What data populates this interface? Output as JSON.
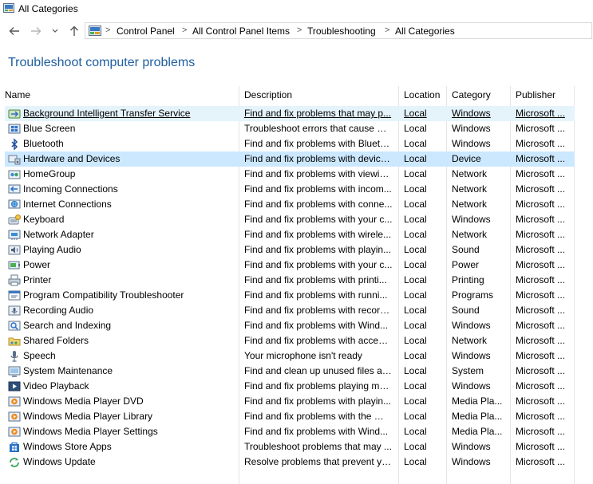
{
  "window": {
    "title": "All Categories",
    "icon": "control-panel-icon"
  },
  "nav": {
    "back_icon": "arrow-left-icon",
    "forward_icon": "arrow-right-icon",
    "recent_icon": "chevron-down-icon",
    "up_icon": "arrow-up-icon"
  },
  "breadcrumb": [
    "Control Panel",
    "All Control Panel Items",
    "Troubleshooting",
    "All Categories"
  ],
  "page_title": "Troubleshoot computer problems",
  "columns": {
    "name": "Name",
    "description": "Description",
    "location": "Location",
    "category": "Category",
    "publisher": "Publisher"
  },
  "items": [
    {
      "name": "Background Intelligent Transfer Service",
      "description": "Find and fix problems that may p...",
      "location": "Local",
      "category": "Windows",
      "publisher": "Microsoft ...",
      "icon": "transfer-service-icon"
    },
    {
      "name": "Blue Screen",
      "description": "Troubleshoot errors that cause Wi...",
      "location": "Local",
      "category": "Windows",
      "publisher": "Microsoft ...",
      "icon": "windows-flag-icon"
    },
    {
      "name": "Bluetooth",
      "description": "Find and fix problems with Blueto...",
      "location": "Local",
      "category": "Windows",
      "publisher": "Microsoft ...",
      "icon": "bluetooth-icon"
    },
    {
      "name": "Hardware and Devices",
      "description": "Find and fix problems with device...",
      "location": "Local",
      "category": "Device",
      "publisher": "Microsoft ...",
      "icon": "hardware-icon"
    },
    {
      "name": "HomeGroup",
      "description": "Find and fix problems with viewin...",
      "location": "Local",
      "category": "Network",
      "publisher": "Microsoft ...",
      "icon": "homegroup-icon"
    },
    {
      "name": "Incoming Connections",
      "description": "Find and fix problems with incom...",
      "location": "Local",
      "category": "Network",
      "publisher": "Microsoft ...",
      "icon": "incoming-connections-icon"
    },
    {
      "name": "Internet Connections",
      "description": "Find and fix problems with conne...",
      "location": "Local",
      "category": "Network",
      "publisher": "Microsoft ...",
      "icon": "internet-connections-icon"
    },
    {
      "name": "Keyboard",
      "description": "Find and fix problems with your c...",
      "location": "Local",
      "category": "Windows",
      "publisher": "Microsoft ...",
      "icon": "keyboard-icon"
    },
    {
      "name": "Network Adapter",
      "description": "Find and fix problems with wirele...",
      "location": "Local",
      "category": "Network",
      "publisher": "Microsoft ...",
      "icon": "network-adapter-icon"
    },
    {
      "name": "Playing Audio",
      "description": "Find and fix problems with playin...",
      "location": "Local",
      "category": "Sound",
      "publisher": "Microsoft ...",
      "icon": "speaker-icon"
    },
    {
      "name": "Power",
      "description": "Find and fix problems with your c...",
      "location": "Local",
      "category": "Power",
      "publisher": "Microsoft ...",
      "icon": "power-icon"
    },
    {
      "name": "Printer",
      "description": "Find and fix problems with printi...",
      "location": "Local",
      "category": "Printing",
      "publisher": "Microsoft ...",
      "icon": "printer-icon"
    },
    {
      "name": "Program Compatibility Troubleshooter",
      "description": "Find and fix problems with runni...",
      "location": "Local",
      "category": "Programs",
      "publisher": "Microsoft ...",
      "icon": "program-compatibility-icon"
    },
    {
      "name": "Recording Audio",
      "description": "Find and fix problems with record...",
      "location": "Local",
      "category": "Sound",
      "publisher": "Microsoft ...",
      "icon": "microphone-icon"
    },
    {
      "name": "Search and Indexing",
      "description": "Find and fix problems with Wind...",
      "location": "Local",
      "category": "Windows",
      "publisher": "Microsoft ...",
      "icon": "search-icon"
    },
    {
      "name": "Shared Folders",
      "description": "Find and fix problems with access...",
      "location": "Local",
      "category": "Network",
      "publisher": "Microsoft ...",
      "icon": "shared-folder-icon"
    },
    {
      "name": "Speech",
      "description": "Your microphone isn't ready",
      "location": "Local",
      "category": "Windows",
      "publisher": "Microsoft ...",
      "icon": "speech-microphone-icon"
    },
    {
      "name": "System Maintenance",
      "description": "Find and clean up unused files an...",
      "location": "Local",
      "category": "System",
      "publisher": "Microsoft ...",
      "icon": "system-maintenance-icon"
    },
    {
      "name": "Video Playback",
      "description": "Find and fix problems playing mo...",
      "location": "Local",
      "category": "Windows",
      "publisher": "Microsoft ...",
      "icon": "video-icon"
    },
    {
      "name": "Windows Media Player DVD",
      "description": "Find and fix problems with playin...",
      "location": "Local",
      "category": "Media Pla...",
      "publisher": "Microsoft ...",
      "icon": "media-player-icon"
    },
    {
      "name": "Windows Media Player Library",
      "description": "Find and fix problems with the Wi...",
      "location": "Local",
      "category": "Media Pla...",
      "publisher": "Microsoft ...",
      "icon": "media-player-icon"
    },
    {
      "name": "Windows Media Player Settings",
      "description": "Find and fix problems with Wind...",
      "location": "Local",
      "category": "Media Pla...",
      "publisher": "Microsoft ...",
      "icon": "media-player-icon"
    },
    {
      "name": "Windows Store Apps",
      "description": "Troubleshoot problems that may ...",
      "location": "Local",
      "category": "Windows",
      "publisher": "Microsoft ...",
      "icon": "store-icon"
    },
    {
      "name": "Windows Update",
      "description": "Resolve problems that prevent yo...",
      "location": "Local",
      "category": "Windows",
      "publisher": "Microsoft ...",
      "icon": "windows-update-icon"
    }
  ],
  "hovered_item": "Background Intelligent Transfer Service",
  "selected_item": "Hardware and Devices",
  "colors": {
    "title_blue": "#1e5fa0",
    "hover_bg": "#e5f3fb",
    "selected_bg": "#cce8ff"
  }
}
